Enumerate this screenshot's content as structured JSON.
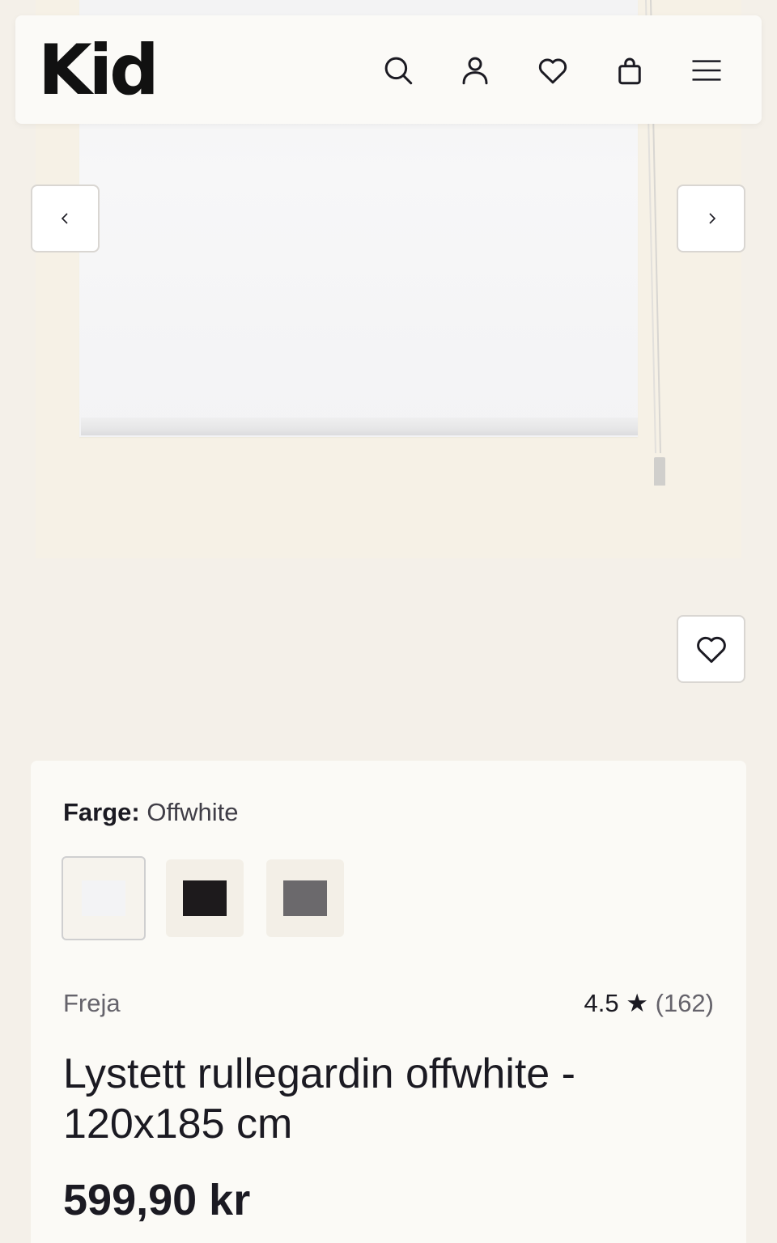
{
  "header": {
    "logo": "Kid",
    "icons": [
      "search-icon",
      "account-icon",
      "heart-icon",
      "shopping-bag-icon",
      "menu-icon"
    ]
  },
  "gallery": {
    "prev_arrow": "‹",
    "next_arrow": "›"
  },
  "product": {
    "color_label": "Farge:",
    "color_value": "Offwhite",
    "swatches": [
      {
        "color": "#f3f3f5",
        "selected": true
      },
      {
        "color": "#1d1a1c",
        "selected": false
      },
      {
        "color": "#6b696c",
        "selected": false
      }
    ],
    "brand": "Freja",
    "rating": "4.5",
    "rating_star": "★",
    "review_count": "(162)",
    "title": "Lystett rullegardin offwhite - 120x185 cm",
    "price": "599,90 kr"
  },
  "colors": {
    "page_bg": "#f4f0e9",
    "panel_bg": "#fbfaf6",
    "text": "#1b1a22",
    "muted": "#65636b"
  }
}
